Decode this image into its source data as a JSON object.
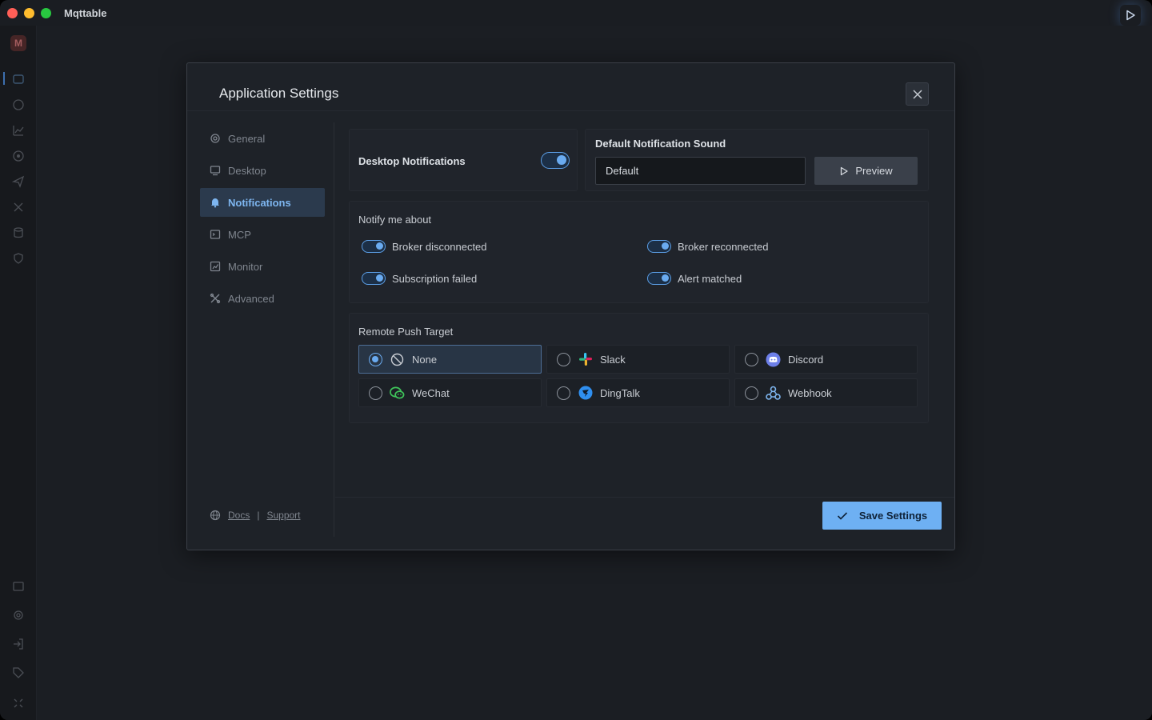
{
  "app": {
    "title": "Mqttable",
    "logo": "M"
  },
  "dialog": {
    "title": "Application Settings",
    "nav": [
      {
        "label": "General",
        "icon": "gear-icon",
        "active": false
      },
      {
        "label": "Desktop",
        "icon": "monitor-icon",
        "active": false
      },
      {
        "label": "Notifications",
        "icon": "bell-icon",
        "active": true
      },
      {
        "label": "MCP",
        "icon": "terminal-icon",
        "active": false
      },
      {
        "label": "Monitor",
        "icon": "chart-icon",
        "active": false
      },
      {
        "label": "Advanced",
        "icon": "tools-icon",
        "active": false
      }
    ],
    "footer": {
      "docs": "Docs",
      "separator": "|",
      "support": "Support"
    }
  },
  "notifications": {
    "desktop_label": "Desktop Notifications",
    "desktop_enabled": true,
    "sound_label": "Default Notification Sound",
    "sound_value": "Default",
    "preview_label": "Preview",
    "notify_title": "Notify me about",
    "events": [
      {
        "label": "Broker disconnected",
        "enabled": true
      },
      {
        "label": "Broker reconnected",
        "enabled": true
      },
      {
        "label": "Subscription failed",
        "enabled": true
      },
      {
        "label": "Alert matched",
        "enabled": true
      }
    ],
    "push_title": "Remote Push Target",
    "targets": [
      {
        "label": "None",
        "icon": "ban-icon",
        "selected": true
      },
      {
        "label": "Slack",
        "icon": "slack-icon",
        "selected": false
      },
      {
        "label": "Discord",
        "icon": "discord-icon",
        "selected": false
      },
      {
        "label": "WeChat",
        "icon": "wechat-icon",
        "selected": false
      },
      {
        "label": "DingTalk",
        "icon": "dingtalk-icon",
        "selected": false
      },
      {
        "label": "Webhook",
        "icon": "webhook-icon",
        "selected": false
      }
    ]
  },
  "actions": {
    "save_label": "Save Settings"
  },
  "colors": {
    "accent": "#6eb0f3",
    "background": "#1a1d22",
    "panel": "#20242b"
  }
}
